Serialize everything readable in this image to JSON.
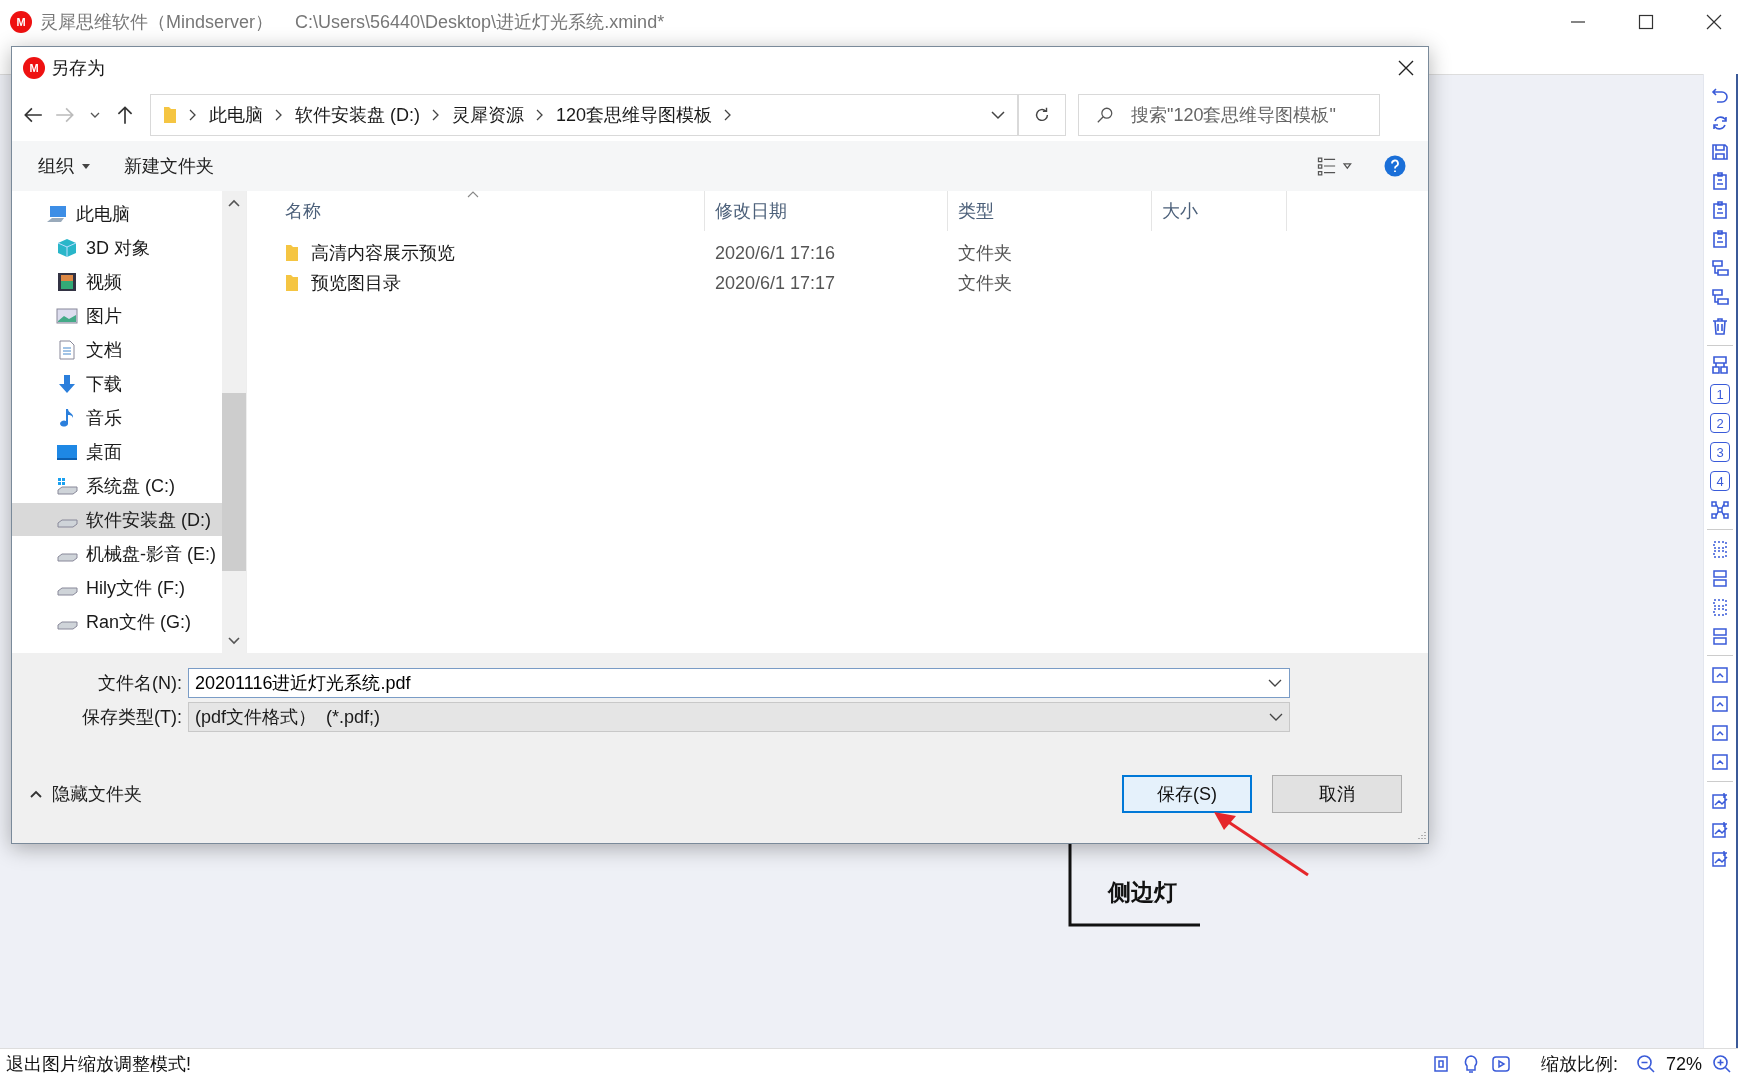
{
  "app_window": {
    "logo": "M",
    "app_name": "灵犀思维软件（Mindserver）",
    "file_path": "C:\\Users\\56440\\Desktop\\进近灯光系统.xmind*"
  },
  "dialog": {
    "logo": "M",
    "title": "另存为",
    "breadcrumb": [
      "此电脑",
      "软件安装盘 (D:)",
      "灵犀资源",
      "120套思维导图模板"
    ],
    "search": {
      "placeholder": "搜索\"120套思维导图模板\""
    },
    "commands": [
      {
        "label": "组织",
        "dropdown": true
      },
      {
        "label": "新建文件夹",
        "dropdown": false
      }
    ],
    "nav_items": [
      {
        "label": "此电脑",
        "kind": "computer",
        "selected": false
      },
      {
        "label": "3D 对象",
        "kind": "cube",
        "selected": false
      },
      {
        "label": "视频",
        "kind": "video",
        "selected": false
      },
      {
        "label": "图片",
        "kind": "image",
        "selected": false
      },
      {
        "label": "文档",
        "kind": "document",
        "selected": false
      },
      {
        "label": "下载",
        "kind": "download",
        "selected": false
      },
      {
        "label": "音乐",
        "kind": "music",
        "selected": false
      },
      {
        "label": "桌面",
        "kind": "desktop",
        "selected": false
      },
      {
        "label": "系统盘 (C:)",
        "kind": "system-drive",
        "selected": false
      },
      {
        "label": "软件安装盘 (D:)",
        "kind": "drive",
        "selected": true
      },
      {
        "label": "机械盘-影音 (E:)",
        "kind": "drive",
        "selected": false
      },
      {
        "label": "Hily文件 (F:)",
        "kind": "drive",
        "selected": false
      },
      {
        "label": "Ran文件 (G:)",
        "kind": "drive",
        "selected": false
      }
    ],
    "columns": [
      "名称",
      "修改日期",
      "类型",
      "大小"
    ],
    "rows": [
      {
        "name": "高清内容展示预览",
        "modified": "2020/6/1 17:16",
        "type": "文件夹"
      },
      {
        "name": "预览图目录",
        "modified": "2020/6/1 17:17",
        "type": "文件夹"
      }
    ],
    "file_name": {
      "label": "文件名(N):",
      "value": "20201116进近灯光系统.pdf"
    },
    "file_type": {
      "label": "保存类型(T):",
      "value": "(pdf文件格式）  (*.pdf;)"
    },
    "hide_folders": "隐藏文件夹",
    "buttons": [
      {
        "label": "保存(S)",
        "primary": true
      },
      {
        "label": "取消",
        "primary": false
      }
    ]
  },
  "canvas": {
    "node": "侧边灯"
  },
  "side_toolbar": {
    "level_buttons": [
      "1",
      "2",
      "3",
      "4"
    ]
  },
  "status_bar": {
    "message": "退出图片缩放调整模式!",
    "zoom_label": "缩放比例:",
    "zoom": "72%"
  }
}
